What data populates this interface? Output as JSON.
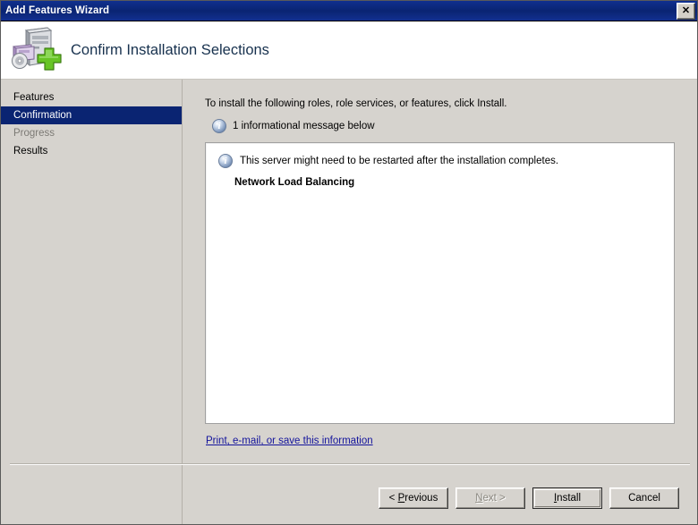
{
  "window": {
    "title": "Add Features Wizard",
    "close_label": "✕"
  },
  "header": {
    "title": "Confirm Installation Selections",
    "icon": "add-features-server-icon"
  },
  "sidebar": {
    "items": [
      {
        "label": "Features",
        "state": "normal"
      },
      {
        "label": "Confirmation",
        "state": "selected"
      },
      {
        "label": "Progress",
        "state": "dim"
      },
      {
        "label": "Results",
        "state": "normal"
      }
    ]
  },
  "main": {
    "intro_text": "To install the following roles, role services, or features, click Install.",
    "message_count_text": "1 informational message below",
    "message_icon": "info-icon",
    "content": {
      "restart_icon": "info-icon",
      "restart_text": "This server might need to be restarted after the installation completes.",
      "feature_name": "Network Load Balancing"
    },
    "print_link": "Print, e-mail, or save this information"
  },
  "footer": {
    "buttons": [
      {
        "name": "previous-button",
        "pre": "< ",
        "accel": "P",
        "post": "revious",
        "state": "enabled",
        "default": false
      },
      {
        "name": "next-button",
        "pre": "",
        "accel": "N",
        "post": "ext >",
        "state": "disabled",
        "default": false
      },
      {
        "name": "install-button",
        "pre": "",
        "accel": "I",
        "post": "nstall",
        "state": "enabled",
        "default": true
      },
      {
        "name": "cancel-button",
        "pre": "",
        "accel": "",
        "post": "Cancel",
        "state": "enabled",
        "default": false
      }
    ]
  },
  "colors": {
    "titlebar": "#0a2472",
    "selection": "#0a2472",
    "body": "#d6d3ce",
    "link": "#14149c",
    "header_title": "#17314e"
  }
}
